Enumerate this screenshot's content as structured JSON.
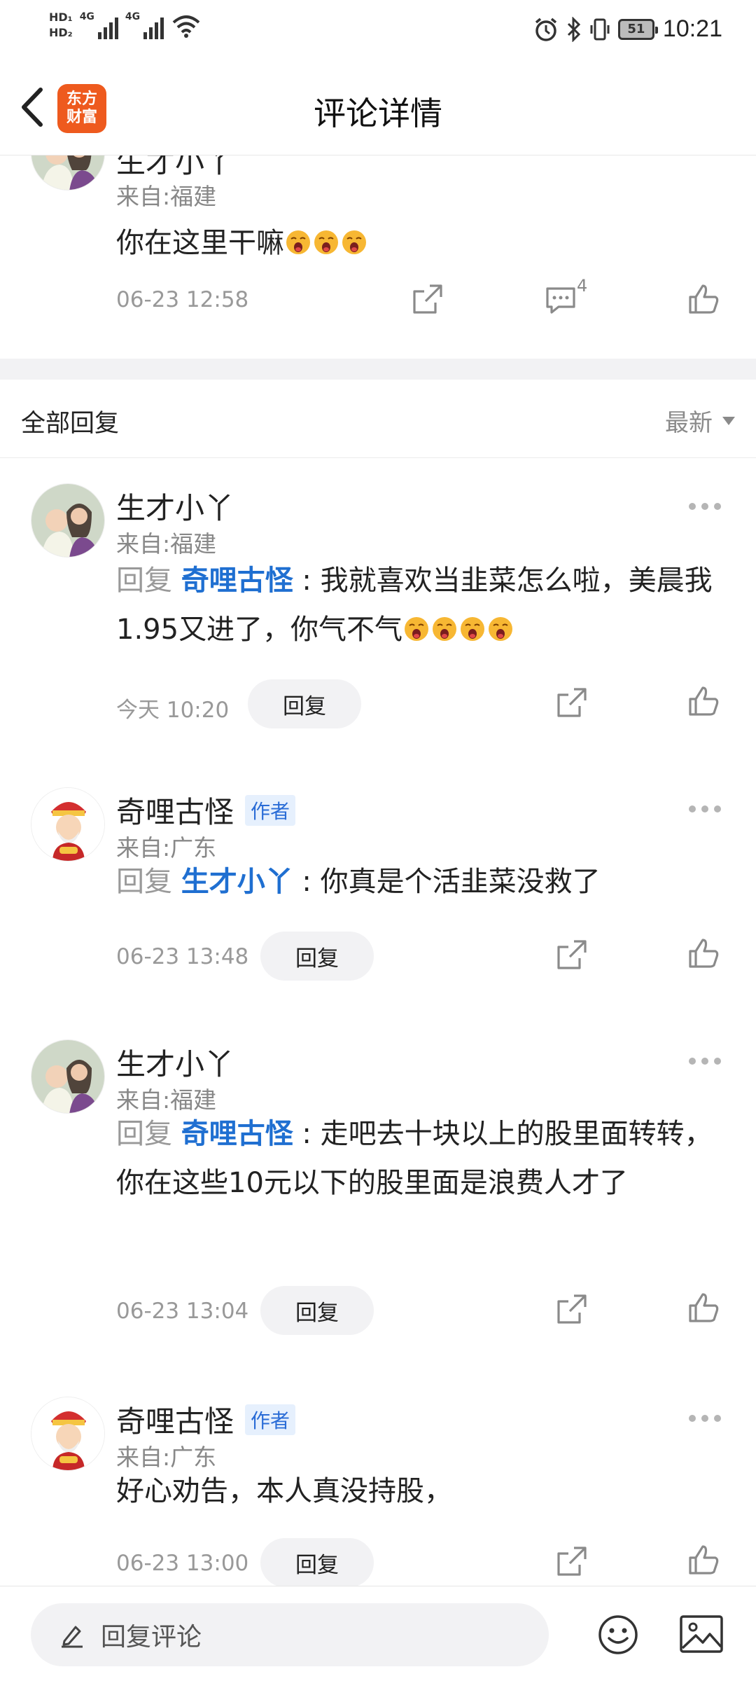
{
  "status": {
    "hd1": "HD₁",
    "hd2": "HD₂",
    "net1": "4G",
    "net2": "4G",
    "battery": "51",
    "time": "10:21"
  },
  "header": {
    "logo_line1": "东方",
    "logo_line2": "财富",
    "title": "评论详情"
  },
  "top_comment": {
    "user": "生才小丫",
    "from": "来自:福建",
    "text": "你在这里干嘛",
    "emoji_count": 3,
    "time": "06-23 12:58",
    "reply_count": "4"
  },
  "section": {
    "label": "全部回复",
    "sort": "最新"
  },
  "replies": [
    {
      "user": "生才小丫",
      "badge": "",
      "from": "来自:福建",
      "reply_prefix": "回复 ",
      "mention": "奇哩古怪",
      "sep": " : ",
      "text": "我就喜欢当韭菜怎么啦，美晨我1.95又进了，你气不气",
      "emoji_count": 4,
      "time": "今天 10:20",
      "reply_label": "回复"
    },
    {
      "user": "奇哩古怪",
      "badge": "作者",
      "from": "来自:广东",
      "reply_prefix": "回复 ",
      "mention": "生才小丫",
      "sep": " : ",
      "text": "你真是个活韭菜没救了",
      "emoji_count": 0,
      "time": "06-23 13:48",
      "reply_label": "回复"
    },
    {
      "user": "生才小丫",
      "badge": "",
      "from": "来自:福建",
      "reply_prefix": "回复 ",
      "mention": "奇哩古怪",
      "sep": " : ",
      "text": "走吧去十块以上的股里面转转，你在这些10元以下的股里面是浪费人才了",
      "emoji_count": 0,
      "time": "06-23 13:04",
      "reply_label": "回复"
    },
    {
      "user": "奇哩古怪",
      "badge": "作者",
      "from": "来自:广东",
      "reply_prefix": "",
      "mention": "",
      "sep": "",
      "text": "好心劝告，本人真没持股，",
      "emoji_count": 0,
      "time": "06-23 13:00",
      "reply_label": "回复"
    }
  ],
  "bottom": {
    "placeholder": "回复评论"
  },
  "colors": {
    "brand": "#ee5a1e",
    "mention": "#1f6fd1",
    "meta": "#999999"
  },
  "icons": [
    "back-arrow-icon",
    "share-icon",
    "comment-icon",
    "like-icon",
    "more-icon",
    "pencil-icon",
    "emoji-icon",
    "image-icon",
    "alarm-icon",
    "bluetooth-icon",
    "vibrate-icon",
    "wifi-icon"
  ]
}
